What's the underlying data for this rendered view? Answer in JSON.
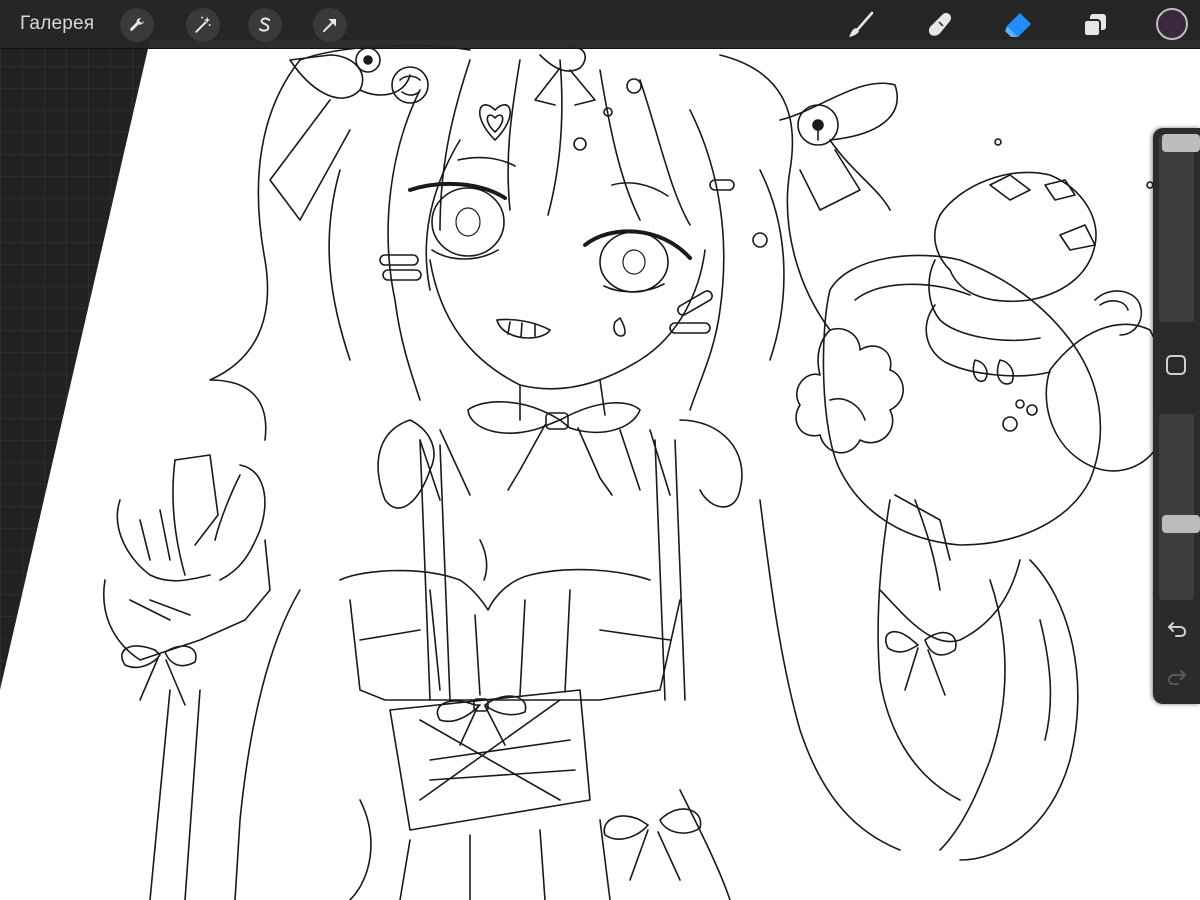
{
  "app": {
    "gallery_label": "Галерея"
  },
  "toolbar": {
    "left_tools": [
      {
        "name": "actions",
        "icon": "wrench-icon"
      },
      {
        "name": "adjustments",
        "icon": "magic-wand-icon"
      },
      {
        "name": "selection",
        "icon": "selection-s-icon"
      },
      {
        "name": "transform",
        "icon": "arrow-cursor-icon"
      }
    ],
    "right_tools": [
      {
        "name": "brush",
        "icon": "brush-icon",
        "active": false
      },
      {
        "name": "smudge",
        "icon": "smudge-finger-icon",
        "active": false
      },
      {
        "name": "eraser",
        "icon": "eraser-icon",
        "active": true
      },
      {
        "name": "layers",
        "icon": "layers-icon",
        "active": false
      }
    ],
    "current_color": "#3b2a3d",
    "accent_color": "#1f8efa"
  },
  "sidebar": {
    "brush_size_level": 1.0,
    "opacity_level": 0.4,
    "modify_icon": "square-outline-icon",
    "undo_icon": "undo-arrow-icon",
    "redo_icon": "redo-arrow-icon",
    "redo_enabled": false
  }
}
